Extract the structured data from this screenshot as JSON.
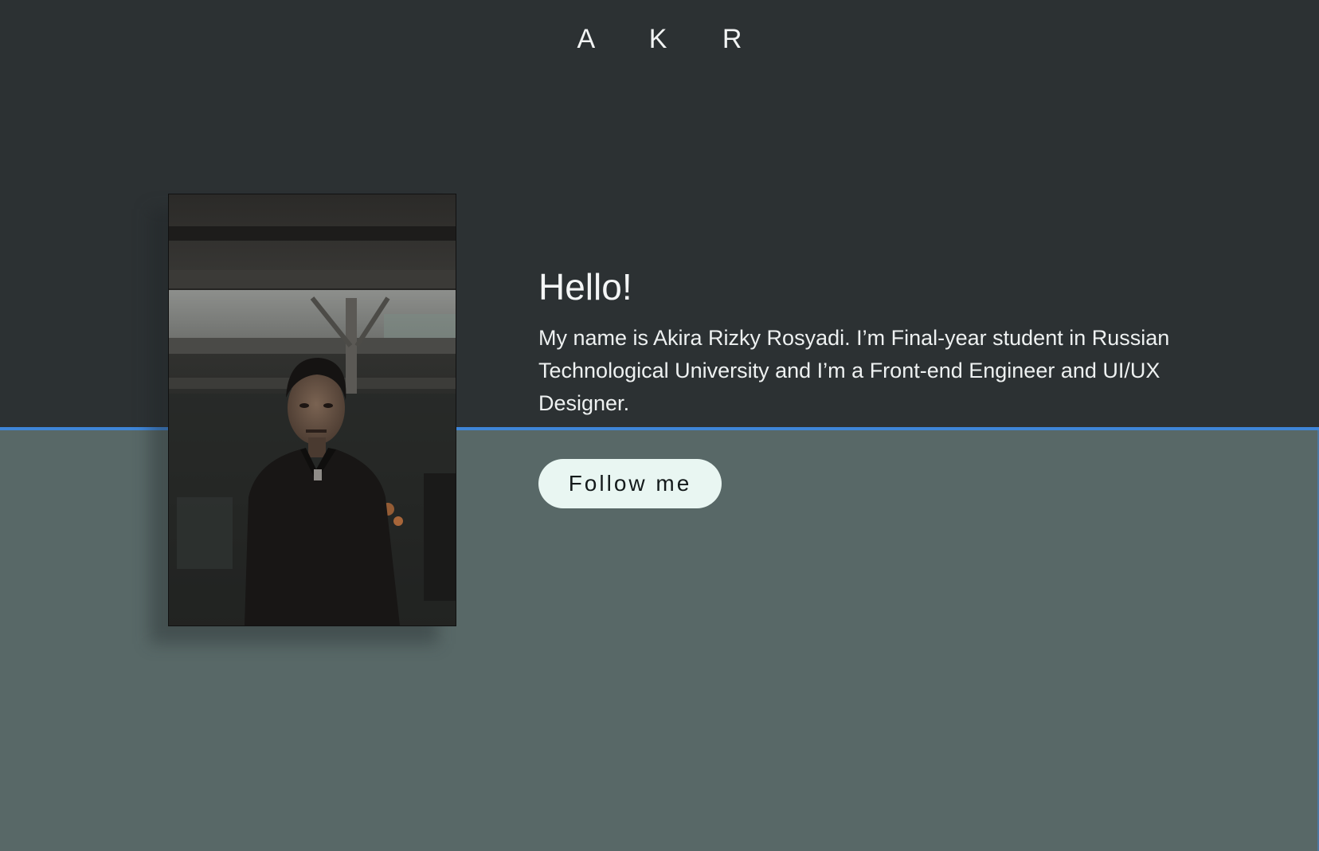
{
  "header": {
    "logo": "A K R"
  },
  "hero": {
    "title": "Hello!",
    "description": "My name is Akira Rizky Rosyadi. I’m Final-year student in Russian Technological University and I’m a Front-end Engineer and UI/UX Designer.",
    "button_label": "Follow me"
  },
  "colors": {
    "top_background": "#2c3133",
    "bottom_background": "#586867",
    "divider": "#3f86d8",
    "button_background": "#e9f6f2"
  },
  "icons": {
    "portrait": "portrait-photo"
  }
}
